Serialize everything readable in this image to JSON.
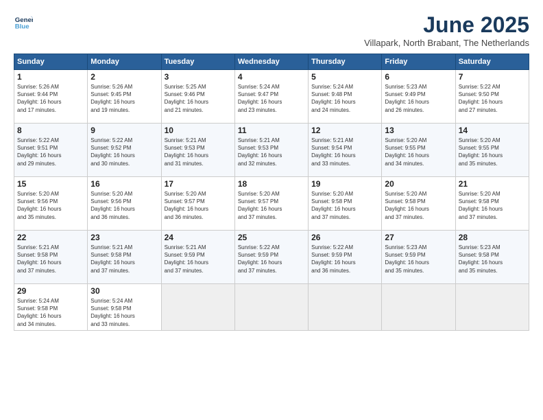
{
  "header": {
    "logo_line1": "General",
    "logo_line2": "Blue",
    "month_title": "June 2025",
    "location": "Villapark, North Brabant, The Netherlands"
  },
  "days_of_week": [
    "Sunday",
    "Monday",
    "Tuesday",
    "Wednesday",
    "Thursday",
    "Friday",
    "Saturday"
  ],
  "weeks": [
    [
      {
        "num": "1",
        "rise": "5:26 AM",
        "set": "9:44 PM",
        "daylight": "16 hours and 17 minutes."
      },
      {
        "num": "2",
        "rise": "5:26 AM",
        "set": "9:45 PM",
        "daylight": "16 hours and 19 minutes."
      },
      {
        "num": "3",
        "rise": "5:25 AM",
        "set": "9:46 PM",
        "daylight": "16 hours and 21 minutes."
      },
      {
        "num": "4",
        "rise": "5:24 AM",
        "set": "9:47 PM",
        "daylight": "16 hours and 23 minutes."
      },
      {
        "num": "5",
        "rise": "5:24 AM",
        "set": "9:48 PM",
        "daylight": "16 hours and 24 minutes."
      },
      {
        "num": "6",
        "rise": "5:23 AM",
        "set": "9:49 PM",
        "daylight": "16 hours and 26 minutes."
      },
      {
        "num": "7",
        "rise": "5:22 AM",
        "set": "9:50 PM",
        "daylight": "16 hours and 27 minutes."
      }
    ],
    [
      {
        "num": "8",
        "rise": "5:22 AM",
        "set": "9:51 PM",
        "daylight": "16 hours and 29 minutes."
      },
      {
        "num": "9",
        "rise": "5:22 AM",
        "set": "9:52 PM",
        "daylight": "16 hours and 30 minutes."
      },
      {
        "num": "10",
        "rise": "5:21 AM",
        "set": "9:53 PM",
        "daylight": "16 hours and 31 minutes."
      },
      {
        "num": "11",
        "rise": "5:21 AM",
        "set": "9:53 PM",
        "daylight": "16 hours and 32 minutes."
      },
      {
        "num": "12",
        "rise": "5:21 AM",
        "set": "9:54 PM",
        "daylight": "16 hours and 33 minutes."
      },
      {
        "num": "13",
        "rise": "5:20 AM",
        "set": "9:55 PM",
        "daylight": "16 hours and 34 minutes."
      },
      {
        "num": "14",
        "rise": "5:20 AM",
        "set": "9:55 PM",
        "daylight": "16 hours and 35 minutes."
      }
    ],
    [
      {
        "num": "15",
        "rise": "5:20 AM",
        "set": "9:56 PM",
        "daylight": "16 hours and 35 minutes."
      },
      {
        "num": "16",
        "rise": "5:20 AM",
        "set": "9:56 PM",
        "daylight": "16 hours and 36 minutes."
      },
      {
        "num": "17",
        "rise": "5:20 AM",
        "set": "9:57 PM",
        "daylight": "16 hours and 36 minutes."
      },
      {
        "num": "18",
        "rise": "5:20 AM",
        "set": "9:57 PM",
        "daylight": "16 hours and 37 minutes."
      },
      {
        "num": "19",
        "rise": "5:20 AM",
        "set": "9:58 PM",
        "daylight": "16 hours and 37 minutes."
      },
      {
        "num": "20",
        "rise": "5:20 AM",
        "set": "9:58 PM",
        "daylight": "16 hours and 37 minutes."
      },
      {
        "num": "21",
        "rise": "5:20 AM",
        "set": "9:58 PM",
        "daylight": "16 hours and 37 minutes."
      }
    ],
    [
      {
        "num": "22",
        "rise": "5:21 AM",
        "set": "9:58 PM",
        "daylight": "16 hours and 37 minutes."
      },
      {
        "num": "23",
        "rise": "5:21 AM",
        "set": "9:58 PM",
        "daylight": "16 hours and 37 minutes."
      },
      {
        "num": "24",
        "rise": "5:21 AM",
        "set": "9:59 PM",
        "daylight": "16 hours and 37 minutes."
      },
      {
        "num": "25",
        "rise": "5:22 AM",
        "set": "9:59 PM",
        "daylight": "16 hours and 37 minutes."
      },
      {
        "num": "26",
        "rise": "5:22 AM",
        "set": "9:59 PM",
        "daylight": "16 hours and 36 minutes."
      },
      {
        "num": "27",
        "rise": "5:23 AM",
        "set": "9:59 PM",
        "daylight": "16 hours and 35 minutes."
      },
      {
        "num": "28",
        "rise": "5:23 AM",
        "set": "9:58 PM",
        "daylight": "16 hours and 35 minutes."
      }
    ],
    [
      {
        "num": "29",
        "rise": "5:24 AM",
        "set": "9:58 PM",
        "daylight": "16 hours and 34 minutes."
      },
      {
        "num": "30",
        "rise": "5:24 AM",
        "set": "9:58 PM",
        "daylight": "16 hours and 33 minutes."
      },
      null,
      null,
      null,
      null,
      null
    ]
  ]
}
